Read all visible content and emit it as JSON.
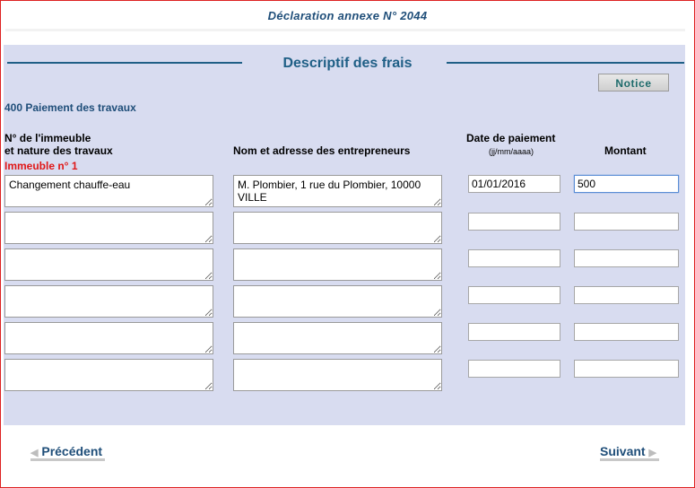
{
  "header": {
    "title": "Déclaration annexe N° 2044"
  },
  "section": {
    "title": "Descriptif des frais",
    "notice_label": "Notice",
    "subtitle": "400 Paiement des travaux"
  },
  "columns": {
    "col1_line1": "N° de l'immeuble",
    "col1_line2": "et nature des travaux",
    "col1_building": "Immeuble n° 1",
    "col2": "Nom et adresse des entrepreneurs",
    "col3": "Date de paiement",
    "col3_format": "(jj/mm/aaaa)",
    "col4": "Montant"
  },
  "rows": [
    {
      "nature": "Changement chauffe-eau",
      "entrepreneur": "M. Plombier, 1 rue du Plombier, 10000 VILLE",
      "date": "01/01/2016",
      "montant": "500"
    },
    {
      "nature": "",
      "entrepreneur": "",
      "date": "",
      "montant": ""
    },
    {
      "nature": "",
      "entrepreneur": "",
      "date": "",
      "montant": ""
    },
    {
      "nature": "",
      "entrepreneur": "",
      "date": "",
      "montant": ""
    },
    {
      "nature": "",
      "entrepreneur": "",
      "date": "",
      "montant": ""
    },
    {
      "nature": "",
      "entrepreneur": "",
      "date": "",
      "montant": ""
    }
  ],
  "navigation": {
    "previous_label": "Précédent",
    "next_label": "Suivant"
  },
  "colors": {
    "accent": "#1f5f86",
    "panel": "#d8dcf0",
    "warning": "#e01818"
  }
}
